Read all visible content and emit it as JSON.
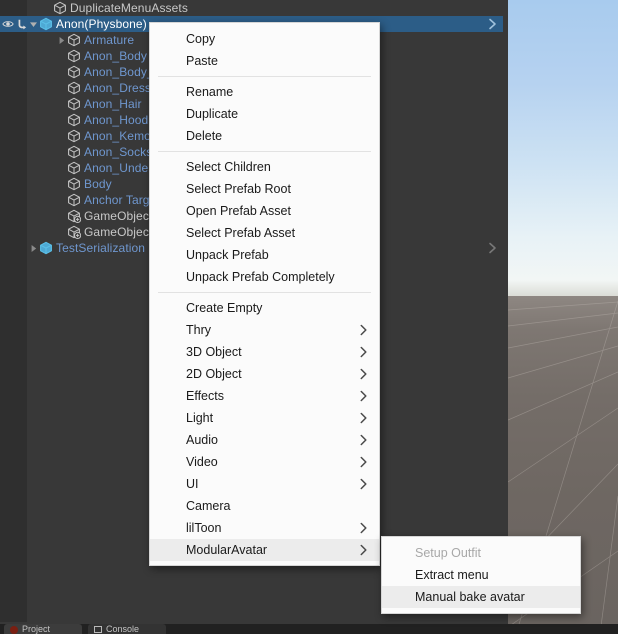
{
  "hierarchy": {
    "rows": [
      {
        "label": "DuplicateMenuAssets",
        "indent": 2,
        "icon": "prefab-cube-icon",
        "color": "plain",
        "twisty": "none",
        "selected": false
      },
      {
        "label": "Anon(Physbone)",
        "indent": 1,
        "icon": "prefab-cube-blue-icon",
        "color": "white",
        "twisty": "down",
        "selected": true
      },
      {
        "label": "Armature",
        "indent": 3,
        "icon": "cube-icon",
        "color": "blue",
        "twisty": "right",
        "selected": false
      },
      {
        "label": "Anon_Body",
        "indent": 3,
        "icon": "cube-icon",
        "color": "blue",
        "twisty": "none",
        "selected": false
      },
      {
        "label": "Anon_Body_Under",
        "indent": 3,
        "icon": "cube-icon",
        "color": "blue",
        "twisty": "none",
        "selected": false
      },
      {
        "label": "Anon_Dress",
        "indent": 3,
        "icon": "cube-icon",
        "color": "blue",
        "twisty": "none",
        "selected": false
      },
      {
        "label": "Anon_Hair",
        "indent": 3,
        "icon": "cube-icon",
        "color": "blue",
        "twisty": "none",
        "selected": false
      },
      {
        "label": "Anon_Hoodie",
        "indent": 3,
        "icon": "cube-icon",
        "color": "blue",
        "twisty": "none",
        "selected": false
      },
      {
        "label": "Anon_Kemono",
        "indent": 3,
        "icon": "cube-icon",
        "color": "blue",
        "twisty": "none",
        "selected": false
      },
      {
        "label": "Anon_Socks",
        "indent": 3,
        "icon": "cube-icon",
        "color": "blue",
        "twisty": "none",
        "selected": false
      },
      {
        "label": "Anon_Underwear",
        "indent": 3,
        "icon": "cube-icon",
        "color": "blue",
        "twisty": "none",
        "selected": false
      },
      {
        "label": "Body",
        "indent": 3,
        "icon": "cube-icon",
        "color": "blue",
        "twisty": "none",
        "selected": false
      },
      {
        "label": "Anchor Target",
        "indent": 3,
        "icon": "cube-icon",
        "color": "blue",
        "twisty": "none",
        "selected": false
      },
      {
        "label": "GameObject",
        "indent": 3,
        "icon": "prefab-variant-cube-icon",
        "color": "plain",
        "twisty": "none",
        "selected": false
      },
      {
        "label": "GameObject",
        "indent": 3,
        "icon": "prefab-variant-cube-icon",
        "color": "plain",
        "twisty": "none",
        "selected": false
      },
      {
        "label": "TestSerialization",
        "indent": 1,
        "icon": "prefab-cube-blue-icon",
        "color": "blue",
        "twisty": "right",
        "selected": false
      }
    ]
  },
  "context_menu": {
    "items": [
      {
        "label": "Copy",
        "submenu": false,
        "disabled": false,
        "highlighted": false
      },
      {
        "label": "Paste",
        "submenu": false,
        "disabled": false,
        "highlighted": false
      },
      {
        "separator": true
      },
      {
        "label": "Rename",
        "submenu": false,
        "disabled": false,
        "highlighted": false
      },
      {
        "label": "Duplicate",
        "submenu": false,
        "disabled": false,
        "highlighted": false
      },
      {
        "label": "Delete",
        "submenu": false,
        "disabled": false,
        "highlighted": false
      },
      {
        "separator": true
      },
      {
        "label": "Select Children",
        "submenu": false,
        "disabled": false,
        "highlighted": false
      },
      {
        "label": "Select Prefab Root",
        "submenu": false,
        "disabled": false,
        "highlighted": false
      },
      {
        "label": "Open Prefab Asset",
        "submenu": false,
        "disabled": false,
        "highlighted": false
      },
      {
        "label": "Select Prefab Asset",
        "submenu": false,
        "disabled": false,
        "highlighted": false
      },
      {
        "label": "Unpack Prefab",
        "submenu": false,
        "disabled": false,
        "highlighted": false
      },
      {
        "label": "Unpack Prefab Completely",
        "submenu": false,
        "disabled": false,
        "highlighted": false
      },
      {
        "separator": true
      },
      {
        "label": "Create Empty",
        "submenu": false,
        "disabled": false,
        "highlighted": false
      },
      {
        "label": "Thry",
        "submenu": true,
        "disabled": false,
        "highlighted": false
      },
      {
        "label": "3D Object",
        "submenu": true,
        "disabled": false,
        "highlighted": false
      },
      {
        "label": "2D Object",
        "submenu": true,
        "disabled": false,
        "highlighted": false
      },
      {
        "label": "Effects",
        "submenu": true,
        "disabled": false,
        "highlighted": false
      },
      {
        "label": "Light",
        "submenu": true,
        "disabled": false,
        "highlighted": false
      },
      {
        "label": "Audio",
        "submenu": true,
        "disabled": false,
        "highlighted": false
      },
      {
        "label": "Video",
        "submenu": true,
        "disabled": false,
        "highlighted": false
      },
      {
        "label": "UI",
        "submenu": true,
        "disabled": false,
        "highlighted": false
      },
      {
        "label": "Camera",
        "submenu": false,
        "disabled": false,
        "highlighted": false
      },
      {
        "label": "lilToon",
        "submenu": true,
        "disabled": false,
        "highlighted": false
      },
      {
        "label": "ModularAvatar",
        "submenu": true,
        "disabled": false,
        "highlighted": true
      }
    ]
  },
  "sub_menu": {
    "items": [
      {
        "label": "Setup Outfit",
        "disabled": true,
        "highlighted": false
      },
      {
        "label": "Extract menu",
        "disabled": false,
        "highlighted": false
      },
      {
        "label": "Manual bake avatar",
        "disabled": false,
        "highlighted": true
      }
    ]
  },
  "bottom_tabs": [
    {
      "label": "Project",
      "icon": "project-icon"
    },
    {
      "label": "Console",
      "icon": "console-icon"
    }
  ],
  "colors": {
    "selection_blue": "#2c5d87",
    "hierarchy_bg": "#383838",
    "menu_bg": "#fbfbfb",
    "menu_highlight": "#ececec",
    "label_blue": "#6f97cf"
  }
}
